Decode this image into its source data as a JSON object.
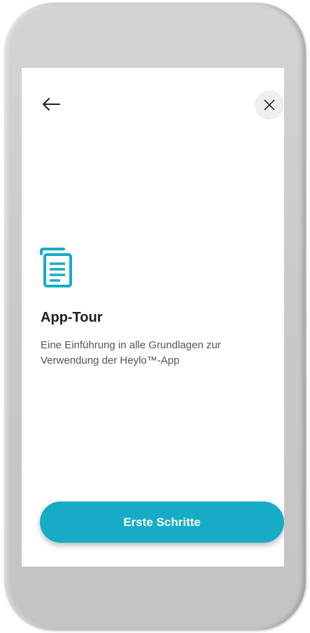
{
  "colors": {
    "accent": "#16acc8",
    "title": "#1f1f1f",
    "body_text": "#555555",
    "close_bg": "#efefef"
  },
  "header": {
    "back_icon": "arrow-left-icon",
    "close_icon": "close-icon"
  },
  "content": {
    "icon": "document-icon",
    "title": "App-Tour",
    "description": "Eine Einführung in alle Grundlagen zur Verwendung der Heylo™-App"
  },
  "footer": {
    "button_label": "Erste Schritte"
  }
}
